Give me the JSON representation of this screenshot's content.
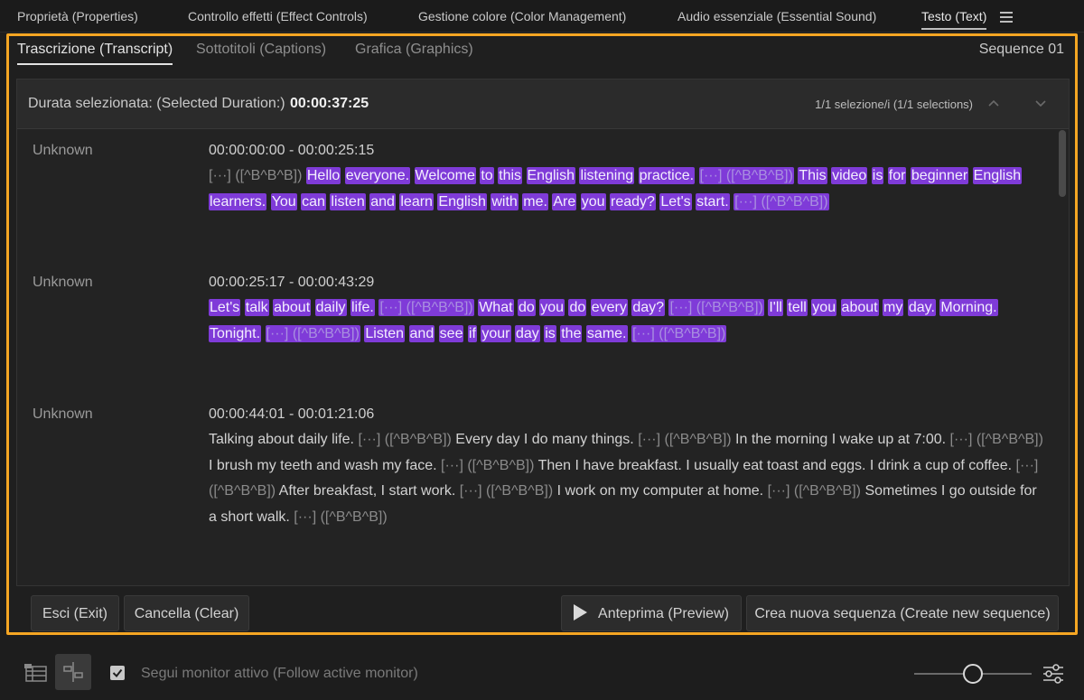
{
  "top_tabs": [
    {
      "label": "Proprietà (Properties)"
    },
    {
      "label": "Controllo effetti (Effect Controls)"
    },
    {
      "label": "Gestione colore (Color Management)"
    },
    {
      "label": "Audio essenziale (Essential Sound)"
    },
    {
      "label": "Testo (Text)"
    }
  ],
  "sub_tabs": [
    {
      "label": "Trascrizione (Transcript)"
    },
    {
      "label": "Sottotitoli (Captions)"
    },
    {
      "label": "Grafica (Graphics)"
    }
  ],
  "sequence_name": "Sequence 01",
  "duration": {
    "label": "Durata selezionata: (Selected Duration:)",
    "value": "00:00:37:25",
    "selection_count": "1/1 selezione/i (1/1 selections)"
  },
  "segments": [
    {
      "speaker": "Unknown",
      "timecode": "00:00:00:00 - 00:00:25:15",
      "tokens": [
        {
          "t": "[···] ([^B^B^B])",
          "p": true,
          "h": false
        },
        {
          "t": "Hello",
          "h": true
        },
        {
          "t": "everyone.",
          "h": true
        },
        {
          "t": "Welcome",
          "h": true
        },
        {
          "t": "to",
          "h": true
        },
        {
          "t": "this",
          "h": true
        },
        {
          "t": "English",
          "h": true
        },
        {
          "t": "listening",
          "h": true
        },
        {
          "t": "practice.",
          "h": true
        },
        {
          "t": "[···] ([^B^B^B])",
          "p": true,
          "h": true
        },
        {
          "t": "This",
          "h": true
        },
        {
          "t": "video",
          "h": true
        },
        {
          "t": "is",
          "h": true
        },
        {
          "t": "for",
          "h": true
        },
        {
          "t": "beginner",
          "h": true
        },
        {
          "t": "English",
          "h": true
        },
        {
          "t": "learners.",
          "h": true
        },
        {
          "t": "You",
          "h": true
        },
        {
          "t": "can",
          "h": true
        },
        {
          "t": "listen",
          "h": true
        },
        {
          "t": "and",
          "h": true
        },
        {
          "t": "learn",
          "h": true
        },
        {
          "t": "English",
          "h": true
        },
        {
          "t": "with",
          "h": true
        },
        {
          "t": "me.",
          "h": true
        },
        {
          "t": "Are",
          "h": true
        },
        {
          "t": "you",
          "h": true
        },
        {
          "t": "ready?",
          "h": true
        },
        {
          "t": "Let's",
          "h": true
        },
        {
          "t": "start.",
          "h": true
        },
        {
          "t": "[···] ([^B^B^B])",
          "p": true,
          "h": true
        }
      ]
    },
    {
      "speaker": "Unknown",
      "timecode": "00:00:25:17 - 00:00:43:29",
      "tokens": [
        {
          "t": "Let's",
          "h": true
        },
        {
          "t": "talk",
          "h": true
        },
        {
          "t": "about",
          "h": true
        },
        {
          "t": "daily",
          "h": true
        },
        {
          "t": "life.",
          "h": true
        },
        {
          "t": "[···] ([^B^B^B])",
          "p": true,
          "h": true
        },
        {
          "t": "What",
          "h": true
        },
        {
          "t": "do",
          "h": true
        },
        {
          "t": "you",
          "h": true
        },
        {
          "t": "do",
          "h": true
        },
        {
          "t": "every",
          "h": true
        },
        {
          "t": "day?",
          "h": true
        },
        {
          "t": "[···] ([^B^B^B])",
          "p": true,
          "h": true
        },
        {
          "t": "I'll",
          "h": true
        },
        {
          "t": "tell",
          "h": true
        },
        {
          "t": "you",
          "h": true
        },
        {
          "t": "about",
          "h": true
        },
        {
          "t": "my",
          "h": true
        },
        {
          "t": "day.",
          "h": true
        },
        {
          "t": "Morning.",
          "h": true
        },
        {
          "t": "Tonight.",
          "h": true
        },
        {
          "t": "[···] ([^B^B^B])",
          "p": true,
          "h": true
        },
        {
          "t": "Listen",
          "h": true
        },
        {
          "t": "and",
          "h": true
        },
        {
          "t": "see",
          "h": true
        },
        {
          "t": "if",
          "h": true
        },
        {
          "t": "your",
          "h": true
        },
        {
          "t": "day",
          "h": true
        },
        {
          "t": "is",
          "h": true
        },
        {
          "t": "the",
          "h": true
        },
        {
          "t": "same.",
          "h": true
        },
        {
          "t": "[···] ([^B^B^B])",
          "p": true,
          "h": true
        }
      ]
    },
    {
      "speaker": "Unknown",
      "timecode": "00:00:44:01 - 00:01:21:06",
      "tokens": [
        {
          "t": "Talking about daily life.",
          "h": false
        },
        {
          "t": "[···] ([^B^B^B])",
          "p": true,
          "h": false
        },
        {
          "t": "Every day I do many things.",
          "h": false
        },
        {
          "t": "[···] ([^B^B^B])",
          "p": true,
          "h": false
        },
        {
          "t": "In the morning I wake up at 7:00.",
          "h": false
        },
        {
          "t": "[···] ([^B^B^B])",
          "p": true,
          "h": false
        },
        {
          "t": "I brush my teeth and wash my face.",
          "h": false
        },
        {
          "t": "[···] ([^B^B^B])",
          "p": true,
          "h": false
        },
        {
          "t": "Then I have breakfast. I usually eat toast and eggs. I drink a cup of coffee.",
          "h": false
        },
        {
          "t": "[···] ([^B^B^B])",
          "p": true,
          "h": false
        },
        {
          "t": "After breakfast, I start work.",
          "h": false
        },
        {
          "t": "[···] ([^B^B^B])",
          "p": true,
          "h": false
        },
        {
          "t": "I work on my computer at home.",
          "h": false
        },
        {
          "t": "[···] ([^B^B^B])",
          "p": true,
          "h": false
        },
        {
          "t": "Sometimes I go outside for a short walk.",
          "h": false
        },
        {
          "t": "[···] ([^B^B^B])",
          "p": true,
          "h": false
        }
      ]
    }
  ],
  "footer": {
    "exit": "Esci (Exit)",
    "clear": "Cancella (Clear)",
    "preview": "Anteprima (Preview)",
    "create": "Crea nuova sequenza (Create new sequence)"
  },
  "bottom": {
    "follow_label": "Segui monitor attivo (Follow active monitor)",
    "follow_checked": true,
    "zoom_slider_level": 0.42
  },
  "colors": {
    "highlight": "#7f3bd8",
    "panel_border": "#f5a623"
  }
}
